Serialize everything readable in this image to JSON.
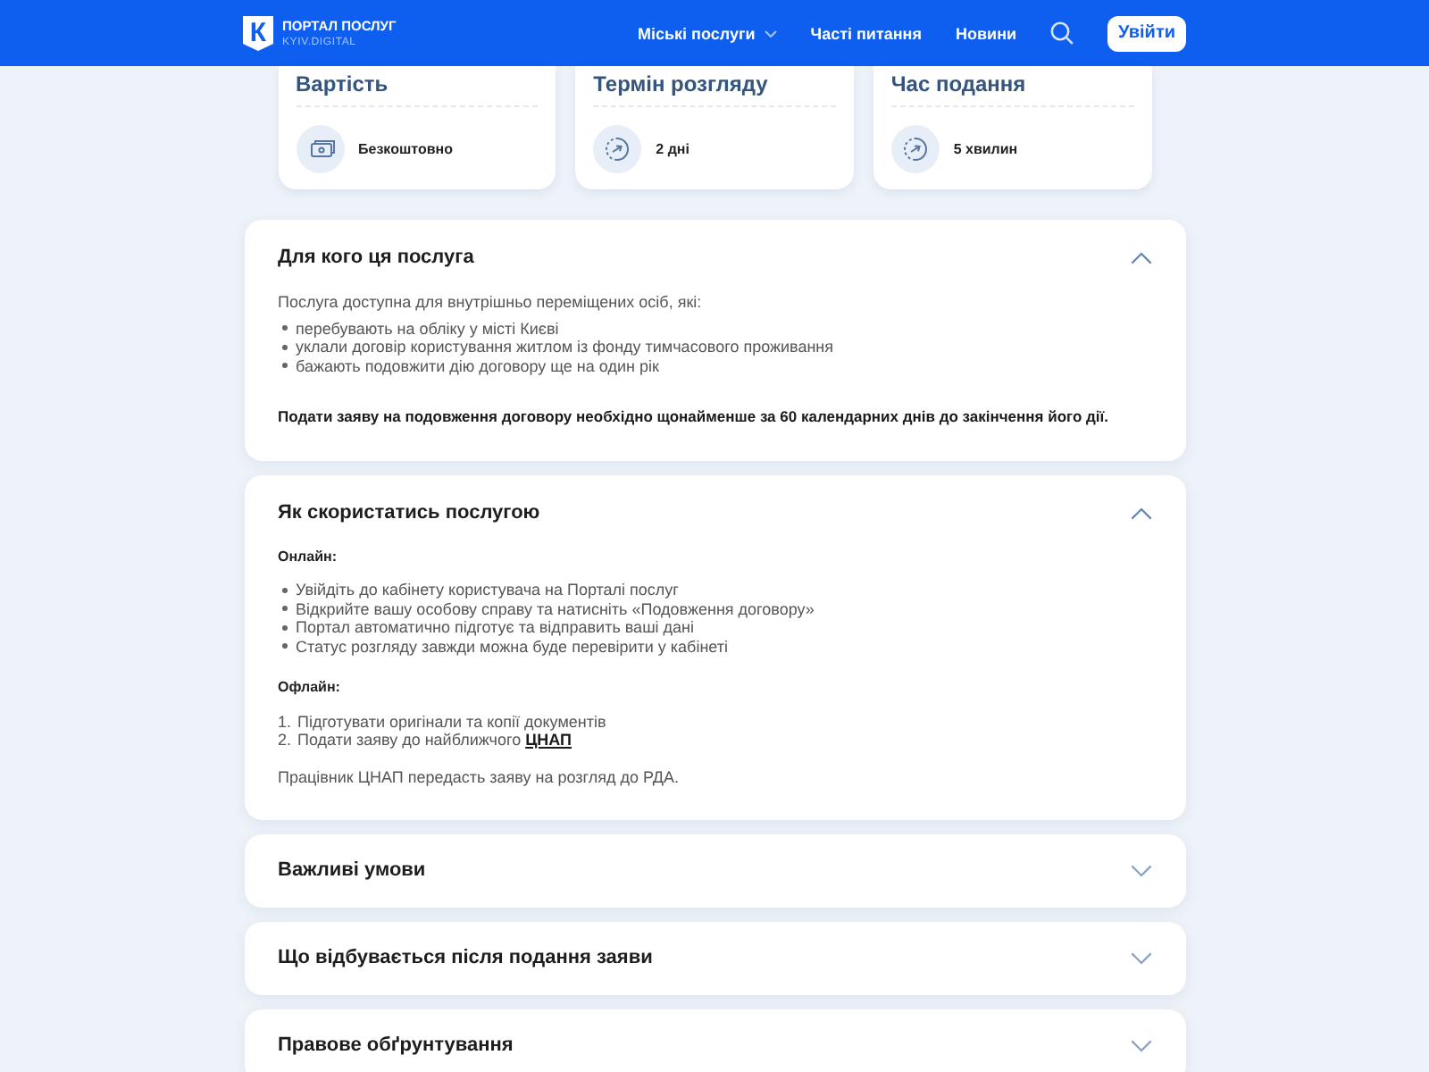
{
  "header": {
    "logo": {
      "mark": "К",
      "title": "ПОРТАЛ ПОСЛУГ",
      "subtitle": "KYIV.DIGITAL"
    },
    "nav": [
      {
        "label": "Міські послуги",
        "dropdown": true
      },
      {
        "label": "Часті питання",
        "dropdown": false
      },
      {
        "label": "Новини",
        "dropdown": false
      }
    ],
    "login_button": "Увійти"
  },
  "info_cards": [
    {
      "kind": "cost",
      "title": "Вартість",
      "value": "Безкоштовно"
    },
    {
      "kind": "time",
      "title": "Термін розгляду",
      "value": "2 дні"
    },
    {
      "kind": "time",
      "title": "Час подання",
      "value": "5 хвилин"
    }
  ],
  "sections": [
    {
      "title": "Для кого ця послуга",
      "expanded": true,
      "content": [
        {
          "kind": "paragraph",
          "text": "Послуга доступна для внутрішньо переміщених осіб, які:"
        },
        {
          "kind": "bullets",
          "items": [
            "перебувають на обліку у місті Києві",
            "уклали договір користування житлом із фонду тимчасового проживання",
            "бажають подовжити дію договору ще на один рік"
          ]
        },
        {
          "kind": "note",
          "text": "Подати заяву на подовження договору необхідно щонайменше за 60 календарних днів до закінчення його дії."
        }
      ]
    },
    {
      "title": "Як скористатись послугою",
      "expanded": true,
      "content": [
        {
          "kind": "heading",
          "text": "Онлайн:"
        },
        {
          "kind": "bullets",
          "items": [
            "Увійдіть до кабінету користувача на Порталі послуг",
            "Відкрийте вашу особову справу та натисніть «Подовження договору»",
            "Портал автоматично підготує та відправить ваші дані",
            "Статус розгляду завжди можна буде перевірити у кабінеті"
          ]
        },
        {
          "kind": "heading",
          "text": "Офлайн:"
        },
        {
          "kind": "numbered",
          "items": [
            {
              "number": "1.",
              "text": "Підготувати оригінали та копії документів"
            },
            {
              "number": "2.",
              "text": "Подати заяву до найближчого",
              "link": "ЦНАП"
            }
          ]
        },
        {
          "kind": "paragraph",
          "text": "Працівник ЦНАП передасть заяву на розгляд до РДА."
        }
      ]
    },
    {
      "title": "Важливі умови",
      "expanded": false
    },
    {
      "title": "Що відбувається після подання заяви",
      "expanded": false
    },
    {
      "title": "Правове обґрунтування",
      "expanded": false
    }
  ]
}
